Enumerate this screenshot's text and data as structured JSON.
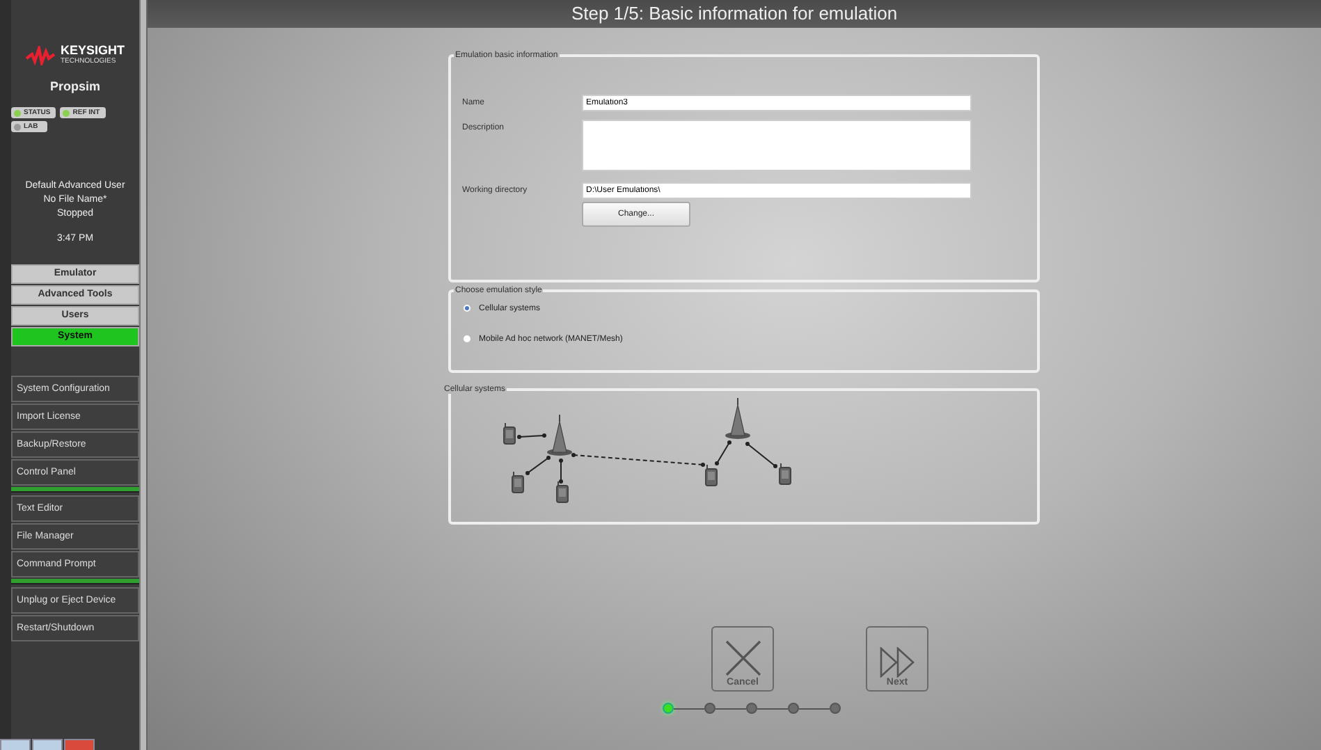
{
  "sidebar": {
    "logo": {
      "brand": "KEYSIGHT",
      "tagline": "TECHNOLOGIES"
    },
    "product": "Propsim",
    "indicators": [
      {
        "label": "STATUS",
        "on": true
      },
      {
        "label": "REF INT",
        "on": true
      },
      {
        "label": "LAB",
        "on": false
      }
    ],
    "user": "Default Advanced User",
    "file": "No File Name*",
    "state": "Stopped",
    "time": "3:47 PM",
    "tabs": [
      {
        "label": "Emulator",
        "selected": false
      },
      {
        "label": "Advanced Tools",
        "selected": false
      },
      {
        "label": "Users",
        "selected": false
      },
      {
        "label": "System",
        "selected": true
      }
    ],
    "tool_groups": [
      [
        "System Configuration",
        "Import License",
        "Backup/Restore",
        "Control Panel"
      ],
      [
        "Text Editor",
        "File Manager",
        "Command Prompt"
      ],
      [
        "Unplug or Eject Device",
        "Restart/Shutdown"
      ]
    ]
  },
  "window": {
    "title": "Step 1/5: Basic information for emulation"
  },
  "basic_info": {
    "legend": "Emulation basic information",
    "name_label": "Name",
    "name_value": "Emulation3",
    "description_label": "Description",
    "directory_label": "Working directory",
    "directory_value": "D:\\User Emulations\\",
    "change_button": "Change..."
  },
  "style_choice": {
    "legend": "Choose emulation style",
    "options": [
      {
        "label": "Cellular systems",
        "selected": true
      },
      {
        "label": "Mobile Ad hoc network (MANET/Mesh)",
        "selected": false
      }
    ]
  },
  "preview": {
    "legend": "Cellular systems"
  },
  "buttons": [
    {
      "kind": "cancel",
      "label": "Cancel"
    },
    {
      "kind": "next",
      "label": "Next"
    }
  ],
  "steps": [
    {
      "selected": true
    },
    {
      "selected": false
    },
    {
      "selected": false
    },
    {
      "selected": false
    },
    {
      "selected": false
    }
  ]
}
